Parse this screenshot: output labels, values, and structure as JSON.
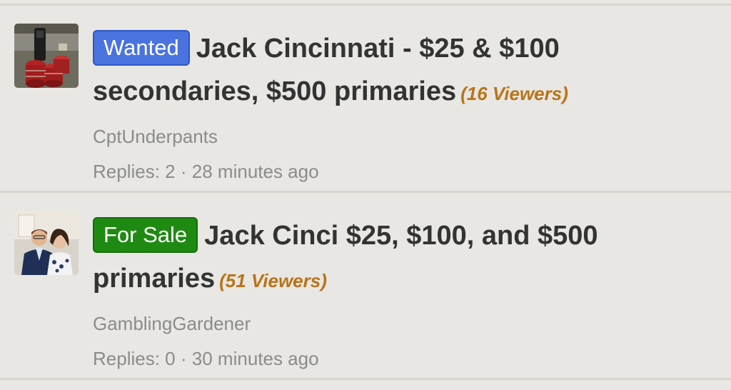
{
  "threads": [
    {
      "prefix": "Wanted",
      "prefix_color": "#4a73e0",
      "title": "Jack Cincinnati - $25 & $100 secondaries, $500 primaries",
      "viewers": "(16 Viewers)",
      "author": "CptUnderpants",
      "replies_label": "Replies:",
      "replies": "2",
      "separator": "·",
      "time": "28 minutes ago"
    },
    {
      "prefix": "For Sale",
      "prefix_color": "#1f8a12",
      "title": "Jack Cinci $25, $100, and $500 primaries",
      "viewers": "(51 Viewers)",
      "author": "GamblingGardener",
      "replies_label": "Replies:",
      "replies": "0",
      "separator": "·",
      "time": "30 minutes ago"
    }
  ],
  "colors": {
    "background": "#e8e7e3",
    "title": "#333333",
    "viewers": "#b8741a",
    "muted": "#8b8b8b"
  }
}
